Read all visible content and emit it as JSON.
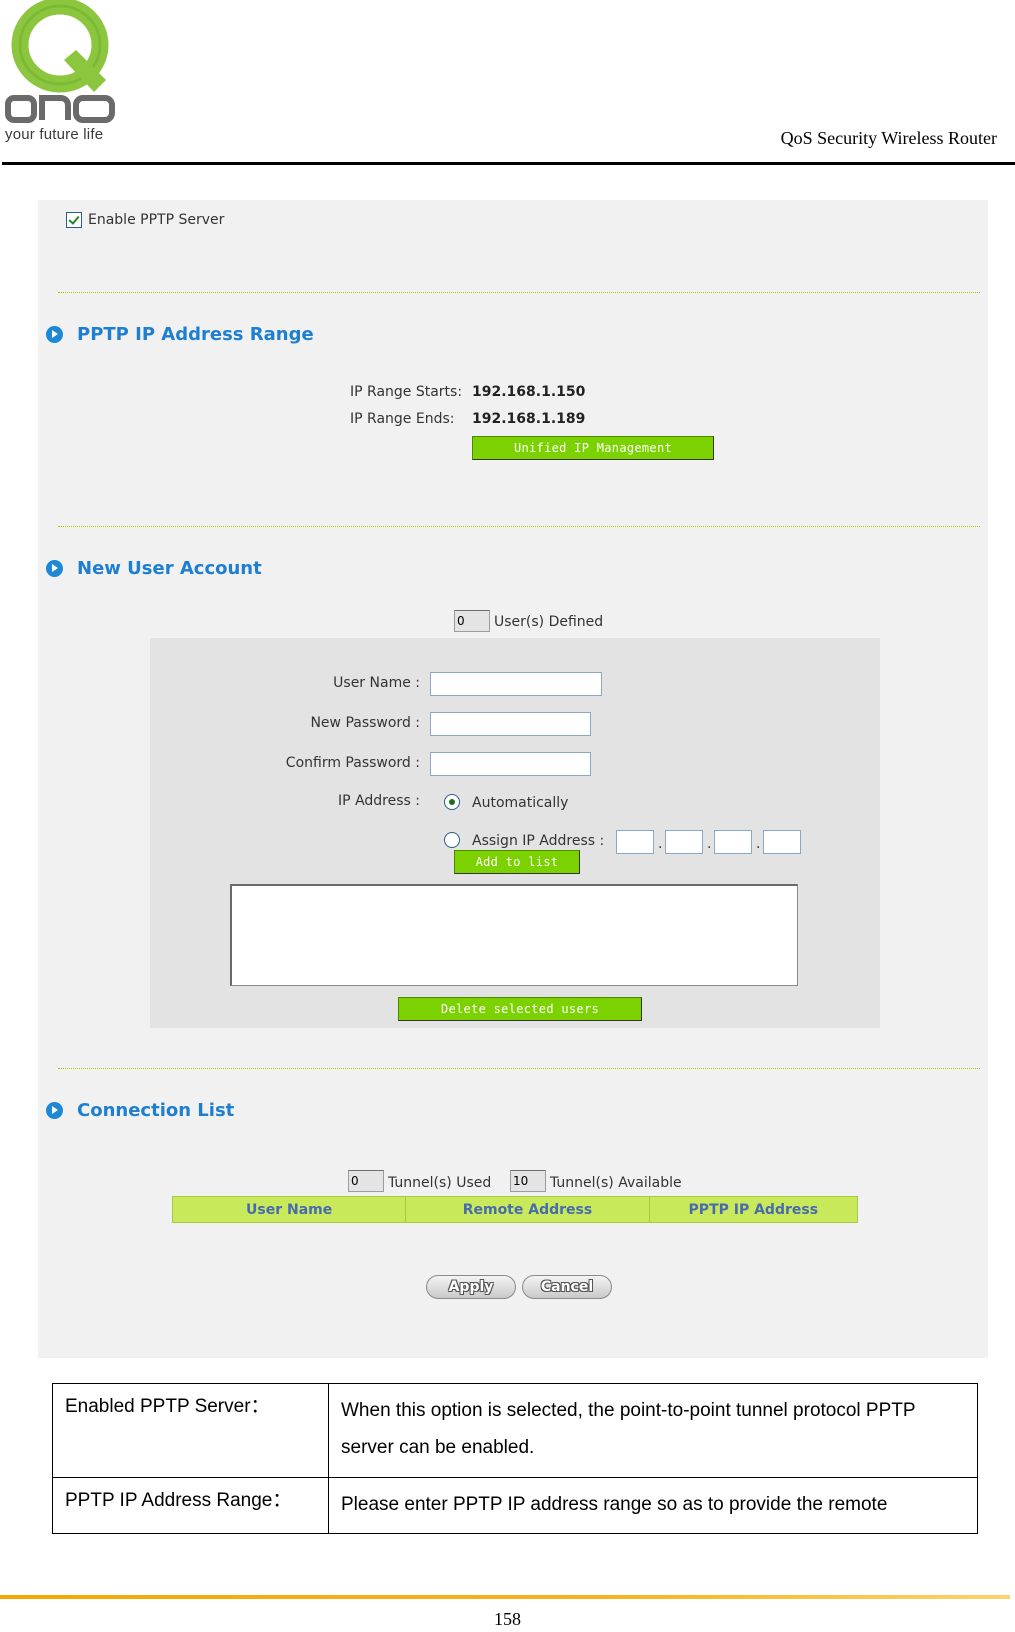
{
  "header": {
    "logo_text": "QNO",
    "logo_tagline": "your future life",
    "doc_title": "QoS Security Wireless Router"
  },
  "pptp": {
    "enable_label": "Enable  PPTP Server",
    "enable_checked": true,
    "ip_range": {
      "section_title": "PPTP IP Address Range",
      "starts_label": "IP Range Starts:",
      "starts_value": "192.168.1.150",
      "ends_label": "IP Range Ends:",
      "ends_value": "192.168.1.189",
      "unified_button": "Unified IP Management"
    },
    "new_user": {
      "section_title": "New User Account",
      "users_defined_count": "0",
      "users_defined_label": "User(s) Defined",
      "user_name_label": "User Name :",
      "user_name_value": "",
      "new_password_label": "New Password :",
      "new_password_value": "",
      "confirm_password_label": "Confirm Password :",
      "confirm_password_value": "",
      "ip_address_label": "IP Address :",
      "ip_options": [
        {
          "label": "Automatically",
          "selected": true
        },
        {
          "label": "Assign IP Address :",
          "selected": false
        }
      ],
      "assign_ip_octets": [
        "",
        "",
        "",
        ""
      ],
      "ip_separator": ".",
      "add_button": "Add to list",
      "user_list": [],
      "delete_button": "Delete selected users"
    },
    "connection_list": {
      "section_title": "Connection List",
      "tunnels_used_count": "0",
      "tunnels_used_label": "Tunnel(s) Used",
      "tunnels_available_count": "10",
      "tunnels_available_label": "Tunnel(s) Available",
      "columns": [
        "User Name",
        "Remote Address",
        "PPTP IP Address"
      ],
      "rows": []
    },
    "actions": {
      "apply": "Apply",
      "cancel": "Cancel"
    }
  },
  "description_table": {
    "rows": [
      {
        "term": "Enabled PPTP Server：",
        "description": "When this option is selected, the point-to-point tunnel protocol PPTP server can be enabled."
      },
      {
        "term": "PPTP IP Address Range：",
        "description": "Please enter PPTP IP address range so as to provide the remote"
      }
    ]
  },
  "footer": {
    "page_number": "158"
  },
  "colors": {
    "accent_blue": "#1e7fd0",
    "button_green": "#7cd200",
    "table_header_green": "#c8ea5a",
    "footer_orange": "#f7a600"
  }
}
